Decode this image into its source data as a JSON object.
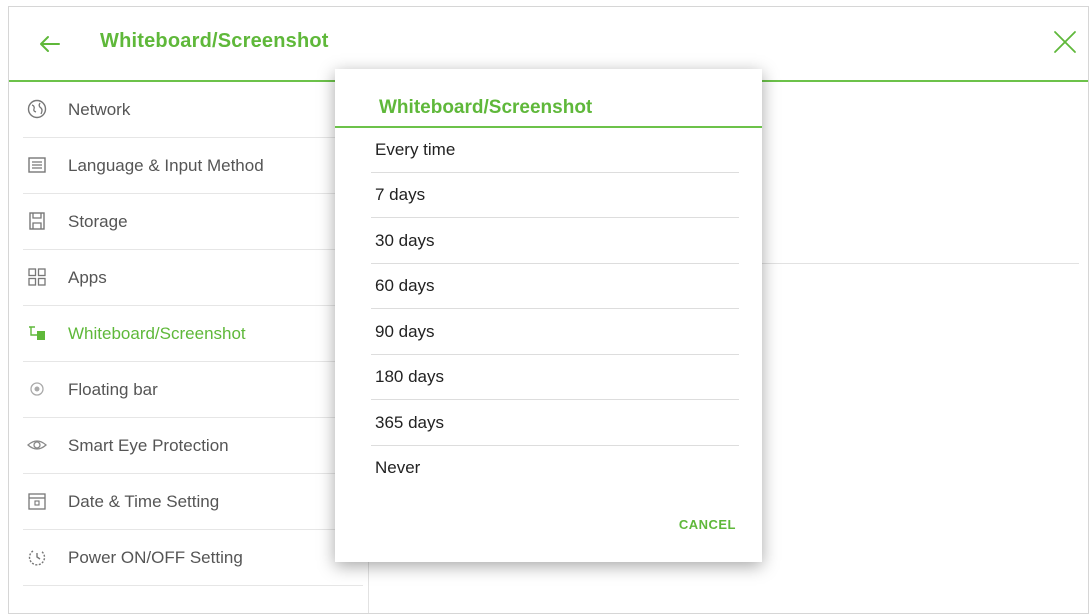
{
  "header": {
    "title": "Whiteboard/Screenshot"
  },
  "sidebar": {
    "items": [
      {
        "label": "Network",
        "icon": "globe-icon"
      },
      {
        "label": "Language & Input Method",
        "icon": "keyboard-icon"
      },
      {
        "label": "Storage",
        "icon": "storage-icon"
      },
      {
        "label": "Apps",
        "icon": "apps-grid-icon"
      },
      {
        "label": "Whiteboard/Screenshot",
        "icon": "whiteboard-icon",
        "active": true
      },
      {
        "label": "Floating bar",
        "icon": "floating-bar-icon"
      },
      {
        "label": "Smart Eye Protection",
        "icon": "eye-icon"
      },
      {
        "label": "Date & Time Setting",
        "icon": "calendar-icon"
      },
      {
        "label": "Power ON/OFF Setting",
        "icon": "power-icon"
      }
    ]
  },
  "dialog": {
    "title": "Whiteboard/Screenshot",
    "options": [
      "Every time",
      "7 days",
      "30 days",
      "60 days",
      "90 days",
      "180 days",
      "365 days",
      "Never"
    ],
    "cancel_label": "CANCEL"
  },
  "colors": {
    "accent": "#5fb83a",
    "text": "#555555",
    "divider": "#e2e2e2"
  }
}
